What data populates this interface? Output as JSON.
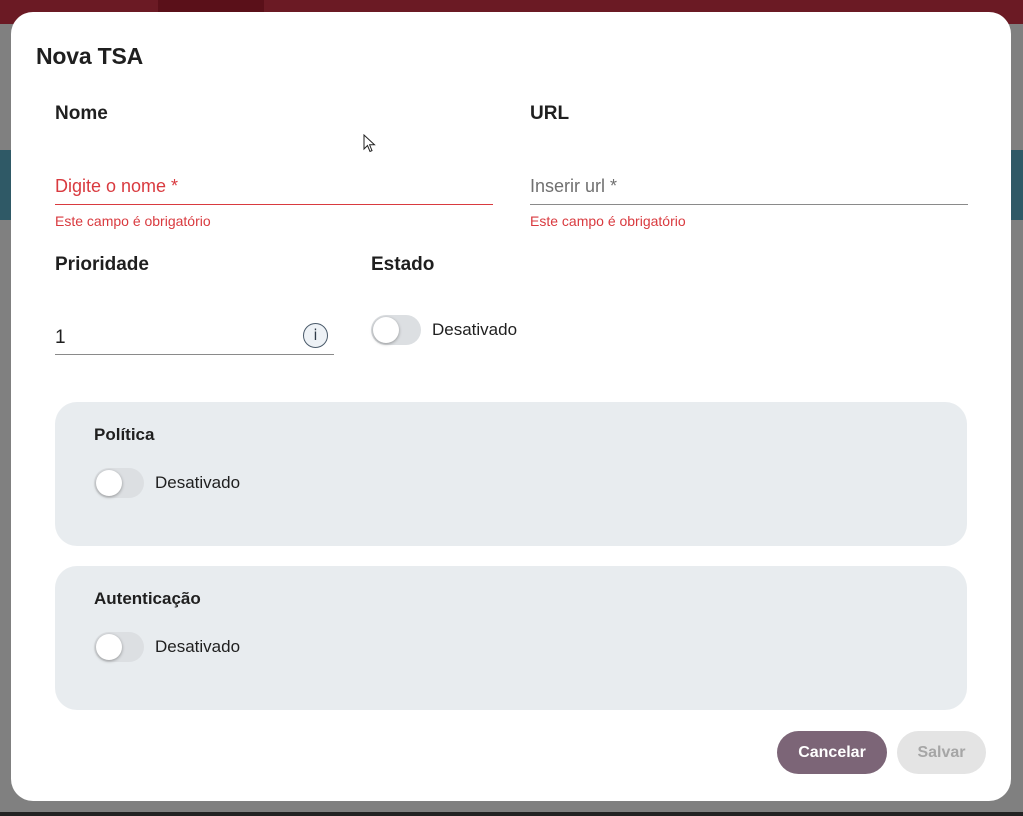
{
  "modal": {
    "title": "Nova TSA",
    "name_field": {
      "label": "Nome",
      "placeholder": "Digite o nome *",
      "error": "Este campo é obrigatório"
    },
    "url_field": {
      "label": "URL",
      "placeholder": "Inserir url *",
      "error": "Este campo é obrigatório"
    },
    "priority_field": {
      "label": "Prioridade",
      "value": "1",
      "info_icon": "info-icon"
    },
    "state_field": {
      "label": "Estado",
      "toggle_label": "Desativado",
      "enabled": false
    },
    "policy_panel": {
      "title": "Política",
      "toggle_label": "Desativado",
      "enabled": false
    },
    "auth_panel": {
      "title": "Autenticação",
      "toggle_label": "Desativado",
      "enabled": false
    },
    "buttons": {
      "cancel": "Cancelar",
      "save": "Salvar"
    }
  },
  "colors": {
    "error": "#d93a3f",
    "cancel_button": "#7c6577",
    "save_button_disabled": "#e4e4e4",
    "panel_background": "#e8ecef"
  }
}
